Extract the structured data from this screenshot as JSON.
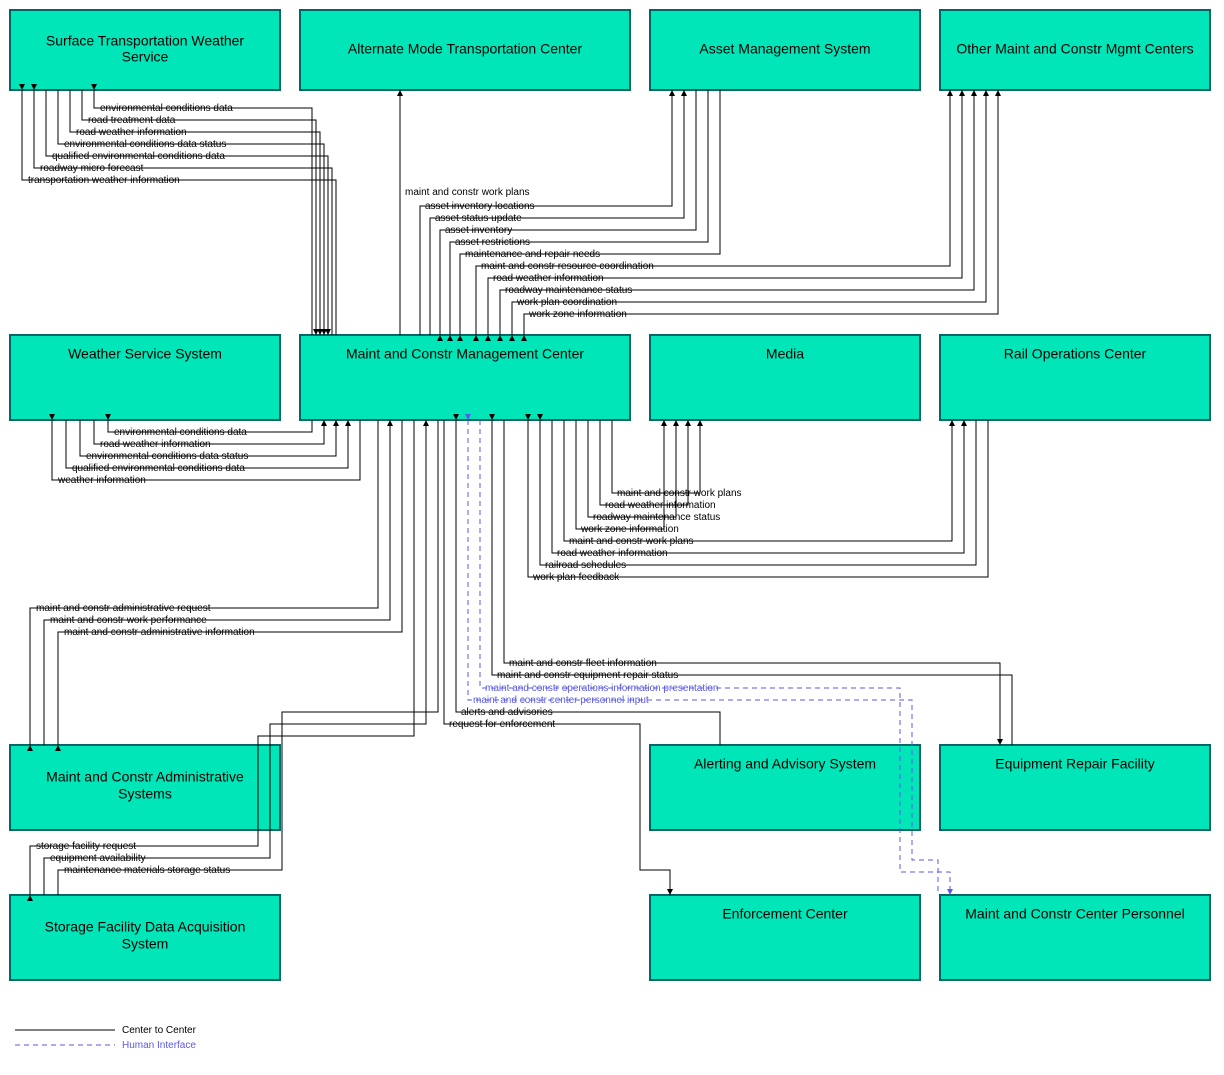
{
  "nodes": {
    "stws": "Surface Transportation Weather Service",
    "amtc": "Alternate Mode Transportation Center",
    "ams": "Asset Management System",
    "ommc": "Other Maint and Constr Mgmt Centers",
    "wss": "Weather Service System",
    "mcmc": "Maint and Constr Management Center",
    "media": "Media",
    "roc": "Rail Operations Center",
    "mcas": "Maint and Constr Administrative Systems",
    "aas": "Alerting and Advisory System",
    "erf": "Equipment Repair Facility",
    "sfdas": "Storage Facility Data Acquisition System",
    "ec": "Enforcement Center",
    "mccp": "Maint and Constr Center Personnel"
  },
  "flows": {
    "stws": [
      "environmental conditions data",
      "road treatment data",
      "road weather information",
      "environmental conditions data status",
      "qualified environmental conditions data",
      "roadway micro forecast",
      "transportation weather information"
    ],
    "amtc_single": "maint and constr work plans",
    "ams": [
      "asset inventory locations",
      "asset status update",
      "asset inventory",
      "asset restrictions",
      "maintenance and repair needs"
    ],
    "ommc": [
      "maint and constr resource coordination",
      "road weather information",
      "roadway maintenance status",
      "work plan coordination",
      "work zone information"
    ],
    "wss": [
      "environmental conditions data",
      "road weather information",
      "environmental conditions data status",
      "qualified environmental conditions data",
      "weather information"
    ],
    "media": [
      "maint and constr work plans",
      "road weather information",
      "roadway maintenance status",
      "work zone information"
    ],
    "roc": [
      "maint and constr work plans",
      "road weather information",
      "railroad schedules",
      "work plan feedback"
    ],
    "mcas": [
      "maint and constr administrative request",
      "maint and constr work performance",
      "maint and constr administrative information"
    ],
    "erf_solid": [
      "maint and constr fleet information",
      "maint and constr equipment repair status"
    ],
    "mccp_dashed": [
      "maint and constr operations information presentation",
      "maint and constr center personnel input"
    ],
    "aas_single": "alerts and advisories",
    "ec_single": "request for enforcement",
    "sfdas": [
      "storage facility request",
      "equipment availability",
      "maintenance materials storage status"
    ]
  },
  "legend": {
    "solid": "Center to Center",
    "dashed": "Human Interface"
  }
}
